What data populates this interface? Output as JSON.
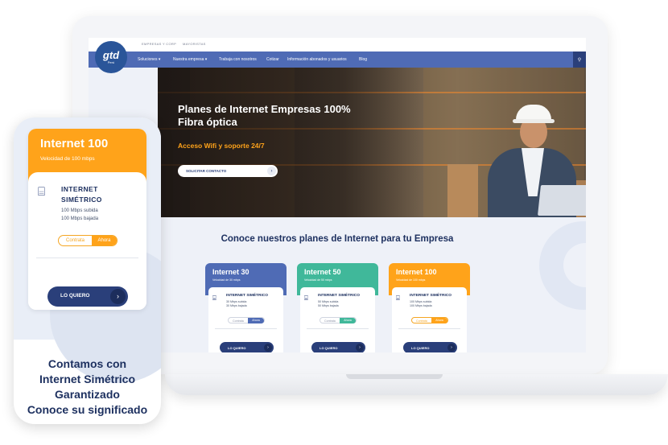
{
  "top_strip": {
    "link1": "EMPRESAS Y CORP",
    "link2": "MAYORISTAS"
  },
  "logo": {
    "text": "gtd",
    "sub": "Perú"
  },
  "nav": {
    "items": [
      "Soluciones ▾",
      "Nuestra empresa ▾",
      "Trabaja con nosotros",
      "Cotizar",
      "Información abonados y usuarios",
      "Blog"
    ],
    "search_icon": "search-icon"
  },
  "hero": {
    "title": "Planes de Internet Empresas 100% Fibra óptica",
    "subtitle": "Acceso Wifi y soporte 24/7",
    "button": "SOLICITAR CONTACTO"
  },
  "section_title": "Conoce nuestros planes de Internet para tu Empresa",
  "plans": [
    {
      "name": "Internet 30",
      "speed": "Velocidad de 30 mbps",
      "title": "INTERNET SIMÉTRICO",
      "up": "30 Mbps subida",
      "down": "30 Mbps bajada",
      "toggle_a": "Contrata",
      "toggle_b": "Ahora",
      "button": "LO QUIERO",
      "color": "#4f6bb5"
    },
    {
      "name": "Internet 50",
      "speed": "Velocidad de 50 mbps",
      "title": "INTERNET SIMÉTRICO",
      "up": "50 Mbps subida",
      "down": "50 Mbps bajada",
      "toggle_a": "Contrata",
      "toggle_b": "Ahora",
      "button": "LO QUIERO",
      "color": "#40b89a"
    },
    {
      "name": "Internet 100",
      "speed": "Velocidad de 100 mbps",
      "title": "INTERNET SIMÉTRICO",
      "up": "100 Mbps subida",
      "down": "100 Mbps bajada",
      "toggle_a": "Contrata",
      "toggle_b": "Ahora",
      "button": "LO QUIERO",
      "color": "#ffa31a"
    }
  ],
  "phone": {
    "card_name": "Internet 100",
    "card_speed": "Velocidad de 100 mbps",
    "card_title_1": "INTERNET",
    "card_title_2": "SIMÉTRICO",
    "up": "100 Mbps subida",
    "down": "100 Mbps bajada",
    "toggle_a": "Contrata",
    "toggle_b": "Ahora",
    "button": "LO QUIERO",
    "caption_1": "Contamos con",
    "caption_2": "Internet Simétrico",
    "caption_3": "Garantizado",
    "caption_4": "Conoce su significado"
  },
  "colors": {
    "brand_blue": "#2a3f7a",
    "nav_blue": "#4f6bb5",
    "orange": "#ffa31a",
    "green": "#40b89a"
  }
}
